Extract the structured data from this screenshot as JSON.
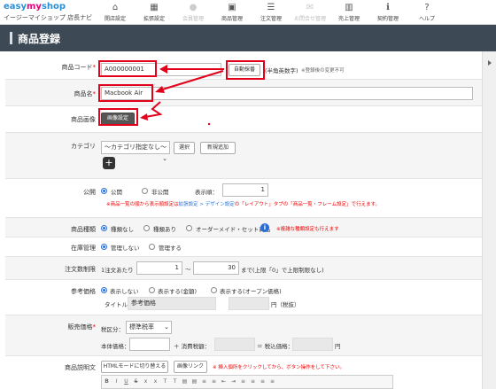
{
  "logo": {
    "brand_a": "easy",
    "brand_b": "my",
    "brand_c": "shop",
    "sub": "イージーマイショップ 店長ナビ"
  },
  "nav": [
    {
      "label": "開店設定",
      "icon": "home-icon",
      "disabled": false
    },
    {
      "label": "拡張設定",
      "icon": "grid-icon",
      "disabled": false
    },
    {
      "label": "会員管理",
      "icon": "user-icon",
      "disabled": true
    },
    {
      "label": "商品管理",
      "icon": "box-icon",
      "disabled": false
    },
    {
      "label": "注文管理",
      "icon": "list-icon",
      "disabled": false
    },
    {
      "label": "お問合せ管理",
      "icon": "mail-icon",
      "disabled": true
    },
    {
      "label": "売上管理",
      "icon": "chart-icon",
      "disabled": false
    },
    {
      "label": "契約管理",
      "icon": "info-icon",
      "disabled": false
    },
    {
      "label": "ヘルプ",
      "icon": "question-icon",
      "disabled": false
    }
  ],
  "page_title": "商品登録",
  "product_code": {
    "label": "商品コード",
    "value": "A000000001",
    "auto_button": "自動採番",
    "hint": "(半角英数字)",
    "note": "※登録後の変更不可"
  },
  "product_name": {
    "label": "商品名",
    "value": "Macbook Air"
  },
  "product_image": {
    "label": "商品画像",
    "button": "画像設定"
  },
  "category": {
    "label": "カテゴリ",
    "select": "〜カテゴリ指定なし〜",
    "select_button": "選択",
    "new_button": "新規追加"
  },
  "public": {
    "label": "公開",
    "opt1": "公開",
    "opt2": "非公開",
    "order_label": "表示順：",
    "order_value": "1",
    "note_a": "※商品一覧の順から表示順設定は",
    "note_link": "拡張設定 > デザイン設定",
    "note_b": "の「レイアウト」タブの「商品一覧・フレーム設定」で行えます。"
  },
  "product_type": {
    "label": "商品種類",
    "opt1": "種類なし",
    "opt2": "種類あり",
    "opt3": "オーダーメイド・セット商品",
    "note": "※複雑な種類設定も行えます"
  },
  "stock": {
    "label": "在庫管理",
    "opt1": "管理しない",
    "opt2": "管理する"
  },
  "order_limit": {
    "label": "注文数制限",
    "prefix": "1注文あたり",
    "min": "1",
    "tilde": "〜",
    "max": "30",
    "suffix": "まで(上限「0」で上限制限なし)"
  },
  "ref_price": {
    "label": "参考価格",
    "opt1": "表示しない",
    "opt2": "表示する(金額)",
    "opt3": "表示する(オープン価格)",
    "title_label": "タイトル：",
    "title_value": "参考価格",
    "yen": "円（税抜）"
  },
  "sale_price": {
    "label": "販売価格",
    "tax_label": "税区分：",
    "tax_value": "標準税率",
    "base_label": "本体価格：",
    "plus": "＋ 消費税額：",
    "eq": "＝ 税込価格：",
    "yen": "円"
  },
  "description": {
    "label": "商品説明文",
    "html_button": "HTMLモードに切り替える",
    "image_link_button": "画像リンク",
    "note": "※ 挿入個所をクリックしてから、ボタン操作をして下さい。"
  }
}
